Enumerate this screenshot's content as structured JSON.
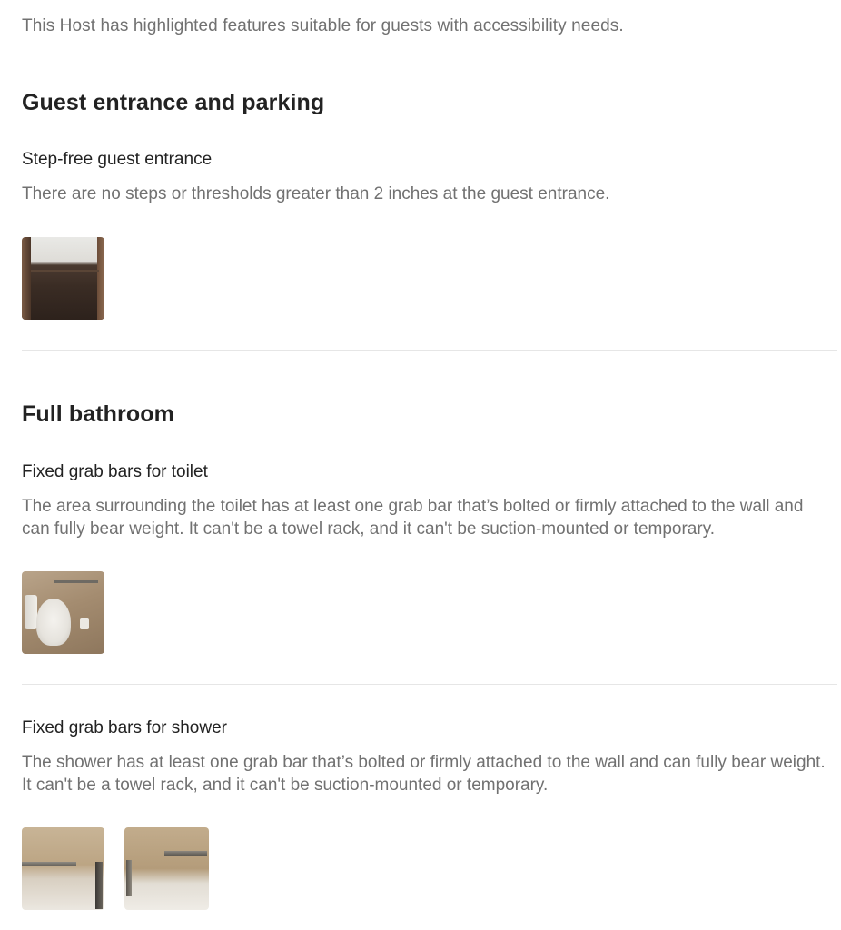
{
  "intro": "This Host has highlighted features suitable for guests with accessibility needs.",
  "sections": [
    {
      "title": "Guest entrance and parking",
      "features": [
        {
          "title": "Step-free guest entrance",
          "description": "There are no steps or thresholds greater than 2 inches at the guest entrance."
        }
      ]
    },
    {
      "title": "Full bathroom",
      "features": [
        {
          "title": "Fixed grab bars for toilet",
          "description": "The area surrounding the toilet has at least one grab bar that’s bolted or firmly attached to the wall and can fully bear weight. It can't be a towel rack, and it can't be suction-mounted or temporary."
        },
        {
          "title": "Fixed grab bars for shower",
          "description": "The shower has at least one grab bar that’s bolted or firmly attached to the wall and can fully bear weight. It can't be a towel rack, and it can't be suction-mounted or temporary."
        }
      ]
    }
  ]
}
